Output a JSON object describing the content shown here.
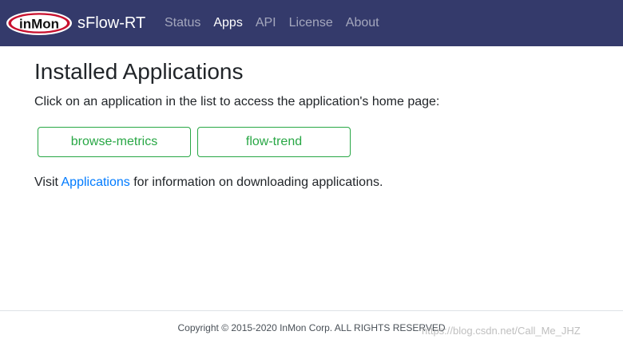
{
  "navbar": {
    "logo_text": "inMon",
    "brand": "sFlow-RT",
    "links": [
      {
        "label": "Status",
        "active": false
      },
      {
        "label": "Apps",
        "active": true
      },
      {
        "label": "API",
        "active": false
      },
      {
        "label": "License",
        "active": false
      },
      {
        "label": "About",
        "active": false
      }
    ]
  },
  "main": {
    "title": "Installed Applications",
    "intro": "Click on an application in the list to access the application's home page:",
    "apps": [
      "browse-metrics",
      "flow-trend"
    ],
    "visit_prefix": "Visit ",
    "visit_link": "Applications",
    "visit_suffix": " for information on downloading applications."
  },
  "footer": {
    "copyright": "Copyright © 2015-2020 InMon Corp. ALL RIGHTS RESERVED"
  },
  "watermark": "https://blog.csdn.net/Call_Me_JHZ",
  "colors": {
    "navbar_bg": "#343a6b",
    "app_button": "#28a745",
    "link": "#007bff",
    "logo_red": "#c8102e"
  }
}
